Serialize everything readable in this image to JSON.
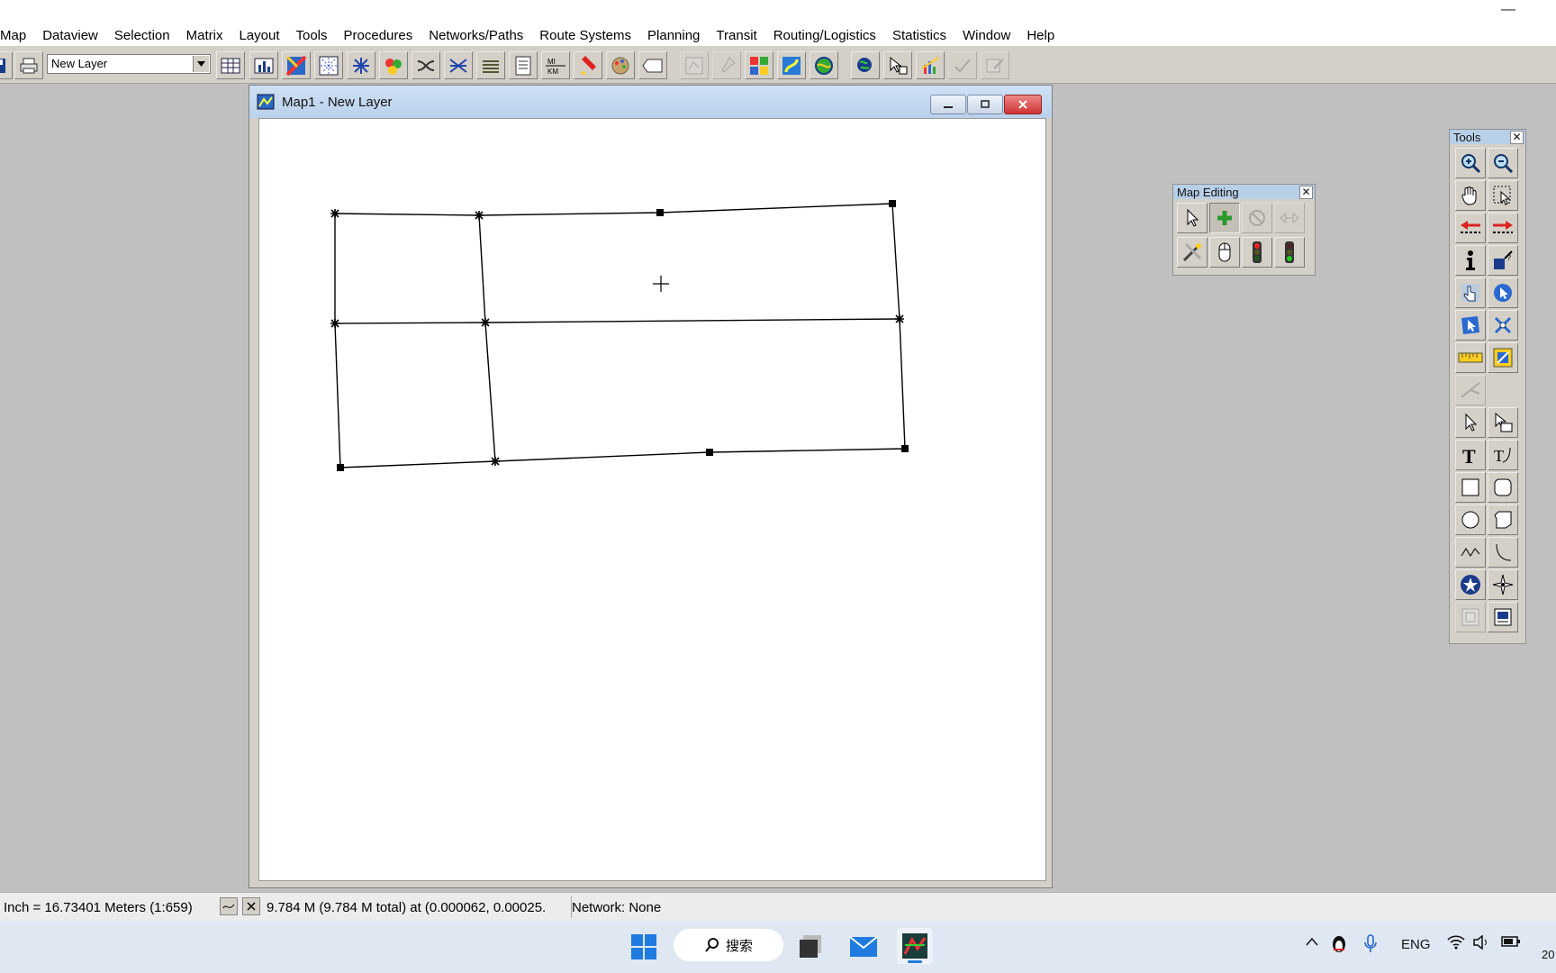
{
  "menu": [
    "Map",
    "Dataview",
    "Selection",
    "Matrix",
    "Layout",
    "Tools",
    "Procedures",
    "Networks/Paths",
    "Route Systems",
    "Planning",
    "Transit",
    "Routing/Logistics",
    "Statistics",
    "Window",
    "Help"
  ],
  "toolbar": {
    "layer_value": "New Layer"
  },
  "map_window": {
    "title": "Map1 - New Layer"
  },
  "panels": {
    "map_editing": {
      "title": "Map Editing"
    },
    "tools": {
      "title": "Tools"
    }
  },
  "status": {
    "scale": "Inch = 16.73401 Meters (1:659)",
    "measure": "9.784 M (9.784 M total) at (0.000062, 0.00025.",
    "network": "Network: None"
  },
  "taskbar": {
    "search": "搜索",
    "lang": "ENG",
    "clock": "20"
  },
  "colors": {
    "map_line": "#000000",
    "title_gradient": "#b9d1ec",
    "chrome": "#d4d0c8"
  }
}
